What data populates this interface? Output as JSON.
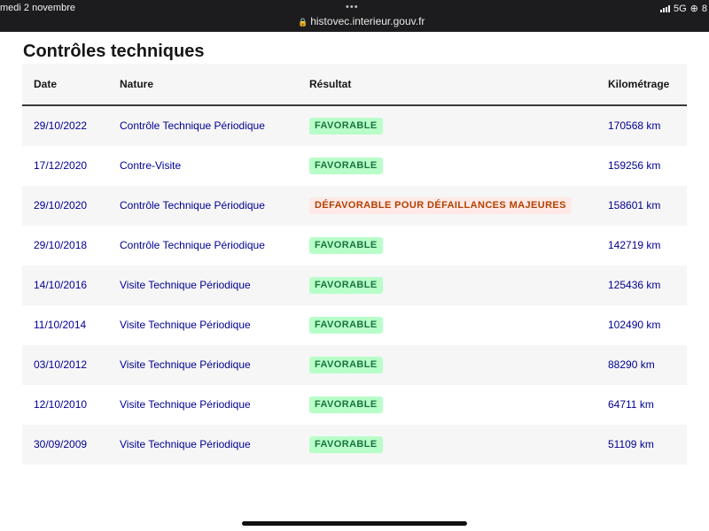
{
  "status_bar": {
    "datetime": "medi 2 novembre",
    "dots": "•••",
    "url": "histovec.interieur.gouv.fr",
    "network": "5G",
    "battery": "8"
  },
  "page": {
    "title": "Contrôles techniques"
  },
  "table": {
    "headers": {
      "date": "Date",
      "nature": "Nature",
      "result": "Résultat",
      "mileage": "Kilométrage"
    },
    "rows": [
      {
        "date": "29/10/2022",
        "nature": "Contrôle Technique Périodique",
        "result": "FAVORABLE",
        "status": "ok",
        "mileage": "170568 km"
      },
      {
        "date": "17/12/2020",
        "nature": "Contre-Visite",
        "result": "FAVORABLE",
        "status": "ok",
        "mileage": "159256 km"
      },
      {
        "date": "29/10/2020",
        "nature": "Contrôle Technique Périodique",
        "result": "DÉFAVORABLE POUR DÉFAILLANCES MAJEURES",
        "status": "ko",
        "mileage": "158601 km"
      },
      {
        "date": "29/10/2018",
        "nature": "Contrôle Technique Périodique",
        "result": "FAVORABLE",
        "status": "ok",
        "mileage": "142719 km"
      },
      {
        "date": "14/10/2016",
        "nature": "Visite Technique Périodique",
        "result": "FAVORABLE",
        "status": "ok",
        "mileage": "125436 km"
      },
      {
        "date": "11/10/2014",
        "nature": "Visite Technique Périodique",
        "result": "FAVORABLE",
        "status": "ok",
        "mileage": "102490 km"
      },
      {
        "date": "03/10/2012",
        "nature": "Visite Technique Périodique",
        "result": "FAVORABLE",
        "status": "ok",
        "mileage": "88290 km"
      },
      {
        "date": "12/10/2010",
        "nature": "Visite Technique Périodique",
        "result": "FAVORABLE",
        "status": "ok",
        "mileage": "64711 km"
      },
      {
        "date": "30/09/2009",
        "nature": "Visite Technique Périodique",
        "result": "FAVORABLE",
        "status": "ok",
        "mileage": "51109 km"
      }
    ]
  },
  "colors": {
    "link_blue": "#000091",
    "favorable_bg": "#b8fec9",
    "favorable_text": "#18753c",
    "defavorable_bg": "#ffe9e6",
    "defavorable_text": "#b34000",
    "row_alt_bg": "#f6f6f6"
  }
}
